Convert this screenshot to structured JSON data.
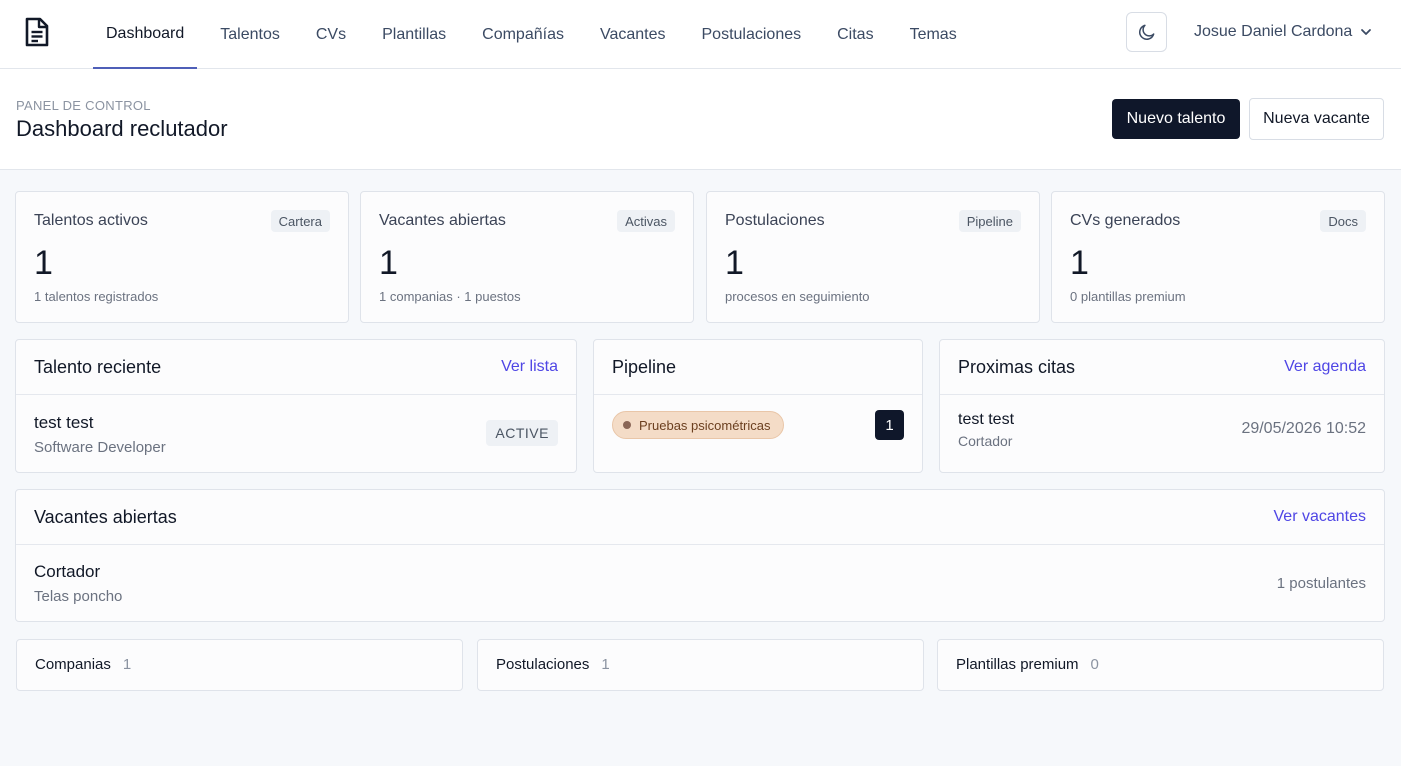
{
  "nav": {
    "items": [
      {
        "label": "Dashboard",
        "active": true
      },
      {
        "label": "Talentos"
      },
      {
        "label": "CVs"
      },
      {
        "label": "Plantillas"
      },
      {
        "label": "Compañías"
      },
      {
        "label": "Vacantes"
      },
      {
        "label": "Postulaciones"
      },
      {
        "label": "Citas"
      },
      {
        "label": "Temas"
      }
    ],
    "user_name": "Josue Daniel Cardona",
    "logo_icon": "document-icon",
    "theme_icon": "moon-icon"
  },
  "header": {
    "eyebrow": "PANEL DE CONTROL",
    "title": "Dashboard reclutador",
    "primary_action": "Nuevo talento",
    "secondary_action": "Nueva vacante"
  },
  "stats": [
    {
      "label": "Talentos activos",
      "badge": "Cartera",
      "value": "1",
      "sub": "1 talentos registrados"
    },
    {
      "label": "Vacantes abiertas",
      "badge": "Activas",
      "value": "1",
      "sub": "1 companias · 1 puestos"
    },
    {
      "label": "Postulaciones",
      "badge": "Pipeline",
      "value": "1",
      "sub": "procesos en seguimiento"
    },
    {
      "label": "CVs generados",
      "badge": "Docs",
      "value": "1",
      "sub": "0 plantillas premium"
    }
  ],
  "recent_talent": {
    "title": "Talento reciente",
    "link": "Ver lista",
    "item": {
      "name": "test test",
      "role": "Software Developer",
      "status": "ACTIVE"
    }
  },
  "pipeline": {
    "title": "Pipeline",
    "stage": {
      "label": "Pruebas psicométricas",
      "count": "1",
      "color": "#f4dcc7"
    }
  },
  "appointments": {
    "title": "Proximas citas",
    "link": "Ver agenda",
    "item": {
      "name": "test test",
      "position": "Cortador",
      "datetime": "29/05/2026 10:52"
    }
  },
  "open_vacancies": {
    "title": "Vacantes abiertas",
    "link": "Ver vacantes",
    "item": {
      "title": "Cortador",
      "company": "Telas poncho",
      "applicants": "1 postulantes"
    }
  },
  "summary": [
    {
      "label": "Companias",
      "value": "1"
    },
    {
      "label": "Postulaciones",
      "value": "1"
    },
    {
      "label": "Plantillas premium",
      "value": "0"
    }
  ],
  "colors": {
    "accent": "#4f46e5",
    "primary_button": "#0f172a",
    "nav_active_underline": "#4f5fb8"
  }
}
